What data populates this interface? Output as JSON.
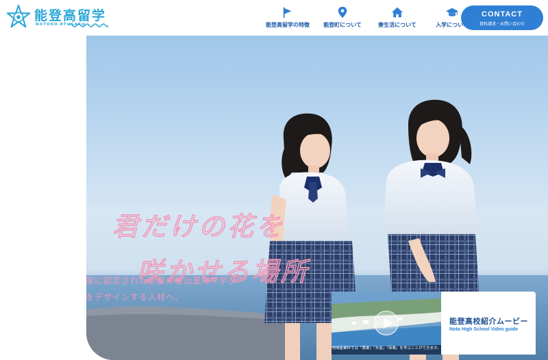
{
  "brand": {
    "title": "能登高留学",
    "subtitle": "NOTOKO-RYUGAKU"
  },
  "nav": [
    {
      "label": "能登高留学の特徴",
      "icon": "flag-icon"
    },
    {
      "label": "能登町について",
      "icon": "map-pin-icon"
    },
    {
      "label": "寮生活について",
      "icon": "house-icon"
    },
    {
      "label": "入学について",
      "icon": "graduation-cap-icon"
    }
  ],
  "contact": {
    "label": "CONTACT",
    "sub": "資料請求・お問い合わせ"
  },
  "hero": {
    "catch_line1": "君だけの花を",
    "catch_line2": "咲かせる場所",
    "tagline_line1": "世界農業遺産に認定された能登の里山里海で学び",
    "tagline_line2": "自分の未来をデザインする人材へ。"
  },
  "video": {
    "caption": "地域産業科では「農業」「水産」「商業」を学ぶことができます。",
    "title": "能登高校紹介ムービー",
    "subtitle": "Noto High School Video guide"
  },
  "colors": {
    "accent": "#2f7fd4",
    "brand": "#2aa7d9",
    "catch": "#f29ab8",
    "nav_text": "#1e5aa8"
  }
}
